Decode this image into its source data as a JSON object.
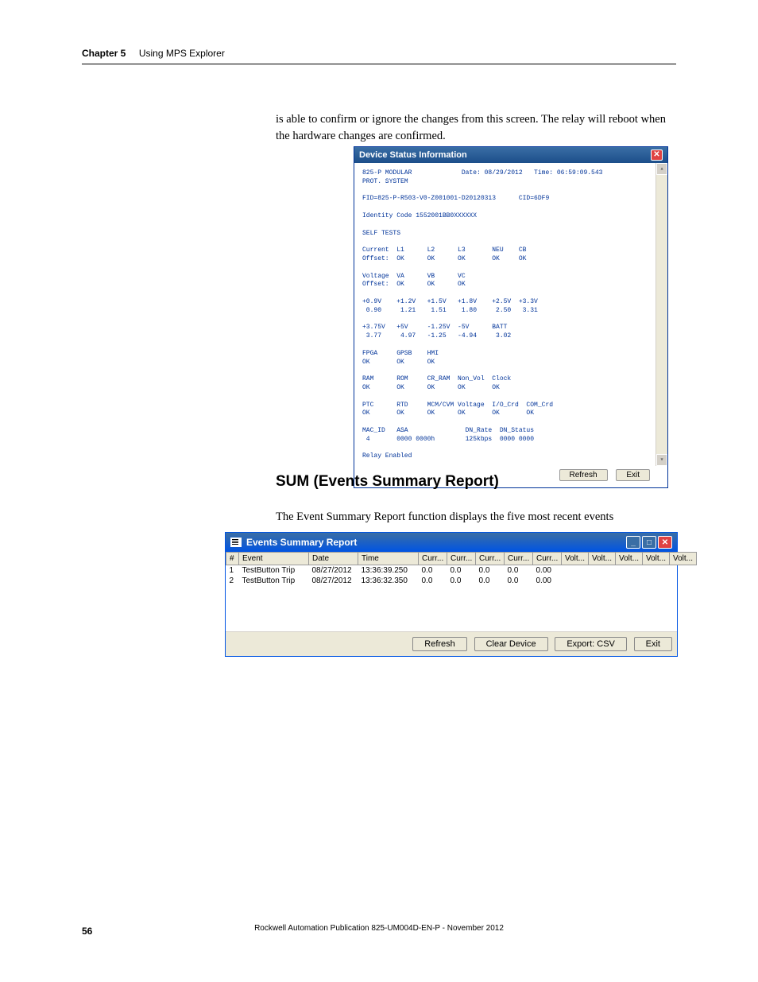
{
  "header": {
    "chapter": "Chapter 5",
    "title": "Using MPS Explorer"
  },
  "intro_paragraph": "is able to confirm or ignore the changes from this screen. The relay will reboot when the hardware changes are confirmed.",
  "device_window": {
    "title": "Device Status Information",
    "header_line": "825-P MODULAR             Date: 08/29/2012   Time: 06:59:09.543\nPROT. SYSTEM",
    "fid_line": "FID=825-P-R503-V0-Z001001-D20120313      CID=6DF9",
    "identity_line": "Identity Code 1552001BB0XXXXXX",
    "self_tests_line": "SELF TESTS",
    "rows": "Current  L1      L2      L3       NEU    CB\nOffset:  OK      OK      OK       OK     OK\n\nVoltage  VA      VB      VC\nOffset:  OK      OK      OK\n\n+0.9V    +1.2V   +1.5V   +1.8V    +2.5V  +3.3V\n 0.90     1.21    1.51    1.80     2.50   3.31\n\n+3.75V   +5V     -1.25V  -5V      BATT\n 3.77     4.97   -1.25   -4.94     3.02\n\nFPGA     GPSB    HMI\nOK       OK      OK\n\nRAM      ROM     CR_RAM  Non_Vol  Clock\nOK       OK      OK      OK       OK\n\nPTC      RTD     MCM/CVM Voltage  I/O_Crd  COM_Crd\nOK       OK      OK      OK       OK       OK\n\nMAC_ID   ASA               DN_Rate  DN_Status\n 4       0000 0000h        125kbps  0000 0000",
    "relay_line": "Relay Enabled",
    "refresh_label": "Refresh",
    "exit_label": "Exit"
  },
  "section_heading": "SUM (Events Summary Report)",
  "summary_paragraph": "The Event Summary Report function displays the five most recent events",
  "events_window": {
    "title": "Events Summary Report",
    "columns": [
      "#",
      "Event",
      "Date",
      "Time",
      "Curr...",
      "Curr...",
      "Curr...",
      "Curr...",
      "Curr...",
      "Volt...",
      "Volt...",
      "Volt...",
      "Volt...",
      "Volt..."
    ],
    "rows": [
      {
        "num": "1",
        "event": "TestButton Trip",
        "date": "08/27/2012",
        "time": "13:36:39.250",
        "c1": "0.0",
        "c2": "0.0",
        "c3": "0.0",
        "c4": "0.0",
        "c5": "0.00",
        "v1": "",
        "v2": "",
        "v3": "",
        "v4": "",
        "v5": ""
      },
      {
        "num": "2",
        "event": "TestButton Trip",
        "date": "08/27/2012",
        "time": "13:36:32.350",
        "c1": "0.0",
        "c2": "0.0",
        "c3": "0.0",
        "c4": "0.0",
        "c5": "0.00",
        "v1": "",
        "v2": "",
        "v3": "",
        "v4": "",
        "v5": ""
      }
    ],
    "refresh_label": "Refresh",
    "clear_label": "Clear Device",
    "export_label": "Export: CSV",
    "exit_label": "Exit"
  },
  "footer": {
    "page": "56",
    "publication": "Rockwell Automation Publication 825-UM004D-EN-P - November 2012"
  }
}
